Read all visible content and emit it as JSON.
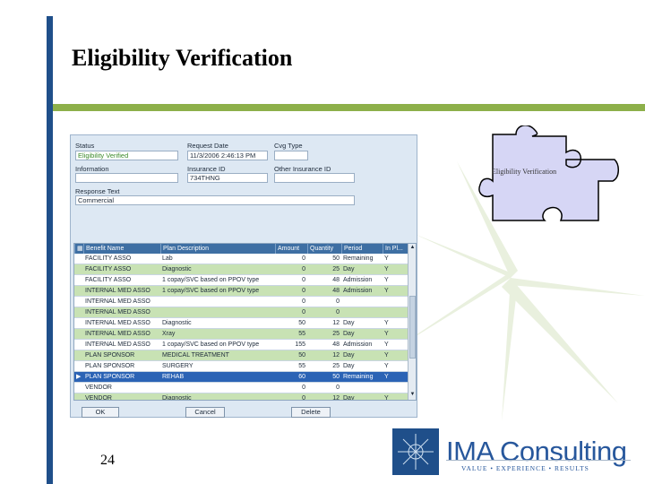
{
  "slide": {
    "title": "Eligibility Verification",
    "page_number": "24"
  },
  "form": {
    "status_label": "Status",
    "status_value": "Eligibility Verified",
    "request_date_label": "Request Date",
    "request_date_value": "11/3/2006 2:46:13 PM",
    "cvg_type_label": "Cvg Type",
    "cvg_type_value": "",
    "information_label": "Information",
    "information_value": "",
    "insurance_id_label": "Insurance ID",
    "insurance_id_value": "734THNG",
    "other_insurance_id_label": "Other Insurance ID",
    "other_insurance_id_value": "",
    "response_text_label": "Response Text",
    "response_text_value": "Commercial"
  },
  "grid": {
    "columns": [
      "Benefit Name",
      "Plan Description",
      "Amount",
      "Quantity",
      "Period",
      "In Pl..."
    ],
    "rows": [
      {
        "benefit": "FACILITY ASSO",
        "plan": "Lab",
        "amount": "0",
        "quantity": "50",
        "period": "Remaining",
        "inplan": "Y"
      },
      {
        "benefit": "FACILITY ASSO",
        "plan": "Diagnostic",
        "amount": "0",
        "quantity": "25",
        "period": "Day",
        "inplan": "Y"
      },
      {
        "benefit": "FACILITY ASSO",
        "plan": "1 copay/SVC based on PPOV type",
        "amount": "0",
        "quantity": "48",
        "period": "Admission",
        "inplan": "Y"
      },
      {
        "benefit": "INTERNAL MED ASSO",
        "plan": "1 copay/SVC based on PPOV type",
        "amount": "0",
        "quantity": "48",
        "period": "Admission",
        "inplan": "Y"
      },
      {
        "benefit": "INTERNAL MED ASSO",
        "plan": "",
        "amount": "0",
        "quantity": "0",
        "period": "",
        "inplan": ""
      },
      {
        "benefit": "INTERNAL MED ASSO",
        "plan": "",
        "amount": "0",
        "quantity": "0",
        "period": "",
        "inplan": ""
      },
      {
        "benefit": "INTERNAL MED ASSO",
        "plan": "Diagnostic",
        "amount": "50",
        "quantity": "12",
        "period": "Day",
        "inplan": "Y"
      },
      {
        "benefit": "INTERNAL MED ASSO",
        "plan": "Xray",
        "amount": "55",
        "quantity": "25",
        "period": "Day",
        "inplan": "Y"
      },
      {
        "benefit": "INTERNAL MED ASSO",
        "plan": "1 copay/SVC based on PPOV type",
        "amount": "155",
        "quantity": "48",
        "period": "Admission",
        "inplan": "Y"
      },
      {
        "benefit": "PLAN SPONSOR",
        "plan": "MEDICAL TREATMENT",
        "amount": "50",
        "quantity": "12",
        "period": "Day",
        "inplan": "Y"
      },
      {
        "benefit": "PLAN SPONSOR",
        "plan": "SURGERY",
        "amount": "55",
        "quantity": "25",
        "period": "Day",
        "inplan": "Y"
      },
      {
        "benefit": "PLAN SPONSOR",
        "plan": "REHAB",
        "amount": "60",
        "quantity": "50",
        "period": "Remaining",
        "inplan": "Y"
      },
      {
        "benefit": "VENDOR",
        "plan": "",
        "amount": "0",
        "quantity": "0",
        "period": "",
        "inplan": ""
      },
      {
        "benefit": "VENDOR",
        "plan": "Diagnostic",
        "amount": "0",
        "quantity": "12",
        "period": "Day",
        "inplan": "Y"
      }
    ],
    "selected_row": 11
  },
  "buttons": {
    "ok": "OK",
    "cancel": "Cancel",
    "delete": "Delete"
  },
  "puzzle_label": "Eligibility Verification",
  "logo": {
    "name": "IMA Consulting",
    "tagline": "VALUE • EXPERIENCE • RESULTS"
  },
  "colors": {
    "accent_blue": "#1f4f8a",
    "accent_green": "#8db04a",
    "row_green": "#c8e2b4",
    "selected_row": "#2b63b5",
    "puzzle_fill": "#d6d6f5"
  }
}
